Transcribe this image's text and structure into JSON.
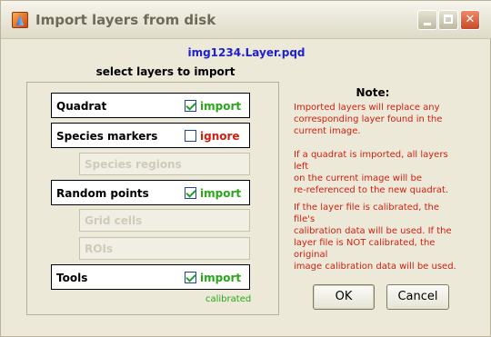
{
  "window": {
    "title": "Import layers from disk"
  },
  "filename": "img1234.Layer.pqd",
  "select_heading": "select layers to import",
  "layers": [
    {
      "name": "Quadrat",
      "checked": true,
      "status": "import"
    },
    {
      "name": "Species markers",
      "checked": false,
      "status": "ignore"
    },
    {
      "name": "Random points",
      "checked": true,
      "status": "import"
    },
    {
      "name": "Tools",
      "checked": true,
      "status": "import"
    }
  ],
  "sublayers": [
    {
      "name": "Species regions"
    },
    {
      "name": "Grid cells"
    },
    {
      "name": "ROIs"
    }
  ],
  "calibrated_label": "calibrated",
  "note": {
    "title": "Note:",
    "para1_lines": [
      "Imported layers will replace any",
      "corresponding layer found in the",
      "current image."
    ],
    "para2_lines": [
      "If a quadrat is imported, all layers left",
      "on the current image will be",
      "re-referenced to the new quadrat."
    ],
    "para3_lines": [
      "If the layer file is calibrated, the file's",
      "calibration data will be used. If the",
      "layer file is NOT calibrated, the original",
      "image calibration data will be used."
    ]
  },
  "buttons": {
    "ok": "OK",
    "cancel": "Cancel"
  },
  "colors": {
    "import": "#2aa61a",
    "ignore": "#d21e10",
    "filename": "#1f1fcf",
    "note": "#d21e10"
  }
}
